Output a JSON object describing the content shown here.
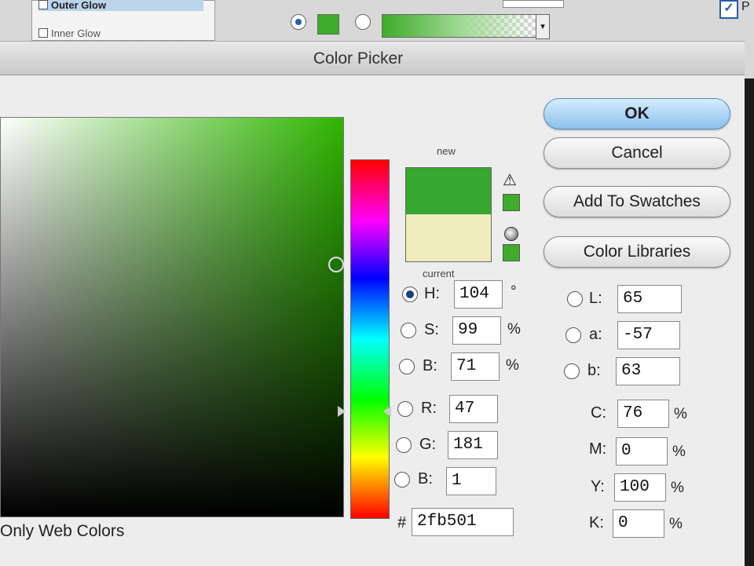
{
  "background": {
    "list_items": [
      "Outer Glow",
      "Inner Glow"
    ],
    "right_checkbox_label": "P"
  },
  "dialog": {
    "title": "Color Picker",
    "only_web_colors_label": "Only Web Colors",
    "new_label": "new",
    "current_label": "current",
    "new_color": "#37a82f",
    "current_color": "#f1ecbd",
    "buttons": {
      "ok": "OK",
      "cancel": "Cancel",
      "add_to_swatches": "Add To Swatches",
      "color_libraries": "Color Libraries"
    },
    "hsb": {
      "h_label": "H:",
      "h_value": "104",
      "h_unit": "°",
      "s_label": "S:",
      "s_value": "99",
      "s_unit": "%",
      "b_label": "B:",
      "b_value": "71",
      "b_unit": "%"
    },
    "rgb": {
      "r_label": "R:",
      "r_value": "47",
      "g_label": "G:",
      "g_value": "181",
      "b_label": "B:",
      "b_value": "1"
    },
    "hex": {
      "label": "#",
      "value": "2fb501"
    },
    "lab": {
      "l_label": "L:",
      "l_value": "65",
      "a_label": "a:",
      "a_value": "-57",
      "b_label": "b:",
      "b_value": "63"
    },
    "cmyk": {
      "c_label": "C:",
      "c_value": "76",
      "m_label": "M:",
      "m_value": "0",
      "y_label": "Y:",
      "y_value": "100",
      "k_label": "K:",
      "k_value": "0",
      "unit": "%"
    }
  }
}
